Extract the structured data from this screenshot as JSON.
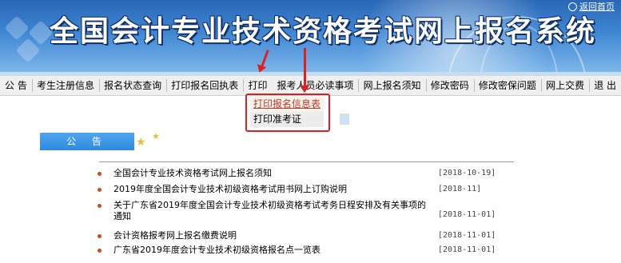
{
  "banner": {
    "title": "全国会计专业技术资格考试网上报名系统",
    "home_link": "返回首页"
  },
  "menu": {
    "items": [
      "公 告",
      "考生注册信息",
      "报名状态查询",
      "打印报名回执表",
      "打印",
      "报考人员必读事项",
      "网上报名须知",
      "修改密码",
      "修改密保问题",
      "网上交费",
      "退 出"
    ]
  },
  "dropdown": {
    "options": [
      "打印报名信息表",
      "打印准考证"
    ]
  },
  "announcement": {
    "header": "公 告",
    "items": [
      {
        "title": "全国会计专业技术资格考试网上报名须知",
        "date": "[2018-10-19]"
      },
      {
        "title": "2019年度全国会计专业技术初级资格考试用书网上订购说明",
        "date": "[2018-11]"
      },
      {
        "title": "关于广东省2019年度全国会计专业技术初级资格考试考务日程安排及有关事项的通知",
        "date": "[2018-11-01]"
      },
      {
        "title": "会计资格报考网上报名缴费说明",
        "date": "[2018-11-01]"
      },
      {
        "title": "广东省2019年度会计专业技术初级资格报名点一览表",
        "date": "[2018-11-01]"
      }
    ]
  },
  "colors": {
    "accent": "#2f8ae0",
    "annotation": "#e02020",
    "bullet": "#d04a1a"
  }
}
